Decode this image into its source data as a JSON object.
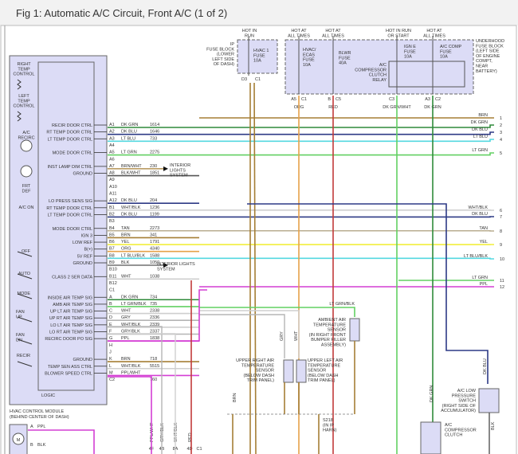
{
  "title": "Fig 1: Automatic A/C Circuit, Front A/C (1 of 2)",
  "wire_colors": {
    "DK GRN": "#2f8a3a",
    "DK BLU": "#2d3a85",
    "LT BLU": "#55d8e0",
    "LT GRN": "#62d062",
    "BRN": "#a57e35",
    "TAN": "#b8ad90",
    "YEL": "#f2ee3c",
    "ORG": "#e6a24a",
    "WHT": "#cfcfcf",
    "PPL": "#d43fd4",
    "RED": "#c23a3a",
    "GRY": "#b5b5b5",
    "BLK": "#555555"
  },
  "module": {
    "name_line1": "HVAC CONTROL MODULE",
    "name_line2": "(BEHIND CENTER OF DASH)",
    "logic": "LOGIC",
    "controls": [
      "RIGHT",
      "TEMP",
      "CONTROL",
      "LEFT",
      "TEMP",
      "CONTROL",
      "A/C",
      "RECIRC",
      "FRT",
      "DEF",
      "A/C ON",
      "OFF",
      "AUTO",
      "MODE",
      "FAN",
      "UP",
      "FAN",
      "DN",
      "RECIR"
    ],
    "pins": [
      {
        "pin": "A1",
        "func": "RECIR DOOR CTRL",
        "color": "DK GRN",
        "circuit": "1614",
        "dest": 2
      },
      {
        "pin": "A2",
        "func": "RT TEMP DOOR CTRL",
        "color": "DK BLU",
        "circuit": "1646",
        "dest": 3
      },
      {
        "pin": "A3",
        "func": "LT TEMP DOOR CTRL",
        "color": "LT BLU",
        "circuit": "733",
        "dest": 4
      },
      {
        "pin": "A4",
        "func": "",
        "color": "",
        "circuit": ""
      },
      {
        "pin": "A5",
        "func": "MODE DOOR CTRL",
        "color": "LT GRN",
        "circuit": "2275",
        "dest": 5
      },
      {
        "pin": "A6",
        "func": "",
        "color": "",
        "circuit": ""
      },
      {
        "pin": "A7",
        "func": "INST LAMP DIM CTRL",
        "color": "BRN/WHT",
        "circuit": "230"
      },
      {
        "pin": "A8",
        "func": "GROUND",
        "color": "BLK/WHT",
        "circuit": "1851"
      },
      {
        "pin": "A9",
        "func": "",
        "color": "",
        "circuit": ""
      },
      {
        "pin": "A10",
        "func": "",
        "color": "",
        "circuit": ""
      },
      {
        "pin": "A11",
        "func": "",
        "color": "",
        "circuit": ""
      },
      {
        "pin": "A12",
        "func": "LO PRESS SENS SIG",
        "color": "DK BLU",
        "circuit": "204"
      },
      {
        "pin": "B1",
        "func": "RT TEMP DOOR CTRL",
        "color": "WHT/BLK",
        "circuit": "1236",
        "dest": 6
      },
      {
        "pin": "B2",
        "func": "LT TEMP DOOR CTRL",
        "color": "DK BLU",
        "circuit": "1199",
        "dest": 7
      },
      {
        "pin": "B3",
        "func": "",
        "color": "",
        "circuit": ""
      },
      {
        "pin": "B4",
        "func": "MODE DOOR CTRL",
        "color": "TAN",
        "circuit": "2273",
        "dest": 8
      },
      {
        "pin": "B5",
        "func": "IGN 3",
        "color": "BRN",
        "circuit": "341"
      },
      {
        "pin": "B6",
        "func": "LOW REF",
        "color": "YEL",
        "circuit": "1791",
        "dest": 9
      },
      {
        "pin": "B7",
        "func": "B(+)",
        "color": "ORG",
        "circuit": "4340"
      },
      {
        "pin": "B8",
        "func": "5V REF",
        "color": "LT BLU/BLK",
        "circuit": "1588",
        "dest": 10
      },
      {
        "pin": "B9",
        "func": "GROUND",
        "color": "BLK",
        "circuit": "1050"
      },
      {
        "pin": "B10",
        "func": "",
        "color": "",
        "circuit": ""
      },
      {
        "pin": "B11",
        "func": "CLASS 2 SER DATA",
        "color": "WHT",
        "circuit": "1038"
      },
      {
        "pin": "B12",
        "func": "",
        "color": "",
        "circuit": ""
      },
      {
        "pin": "C1",
        "func": "",
        "color": "",
        "circuit": ""
      },
      {
        "pin": "A",
        "func": "INSIDE AIR TEMP SIG",
        "color": "DK GRN",
        "circuit": "734"
      },
      {
        "pin": "B",
        "func": "AMB AIR TEMP SIG",
        "color": "LT GRN/BLK",
        "circuit": "735"
      },
      {
        "pin": "C",
        "func": "UP LT AIR TEMP SIG",
        "color": "WHT",
        "circuit": "2338"
      },
      {
        "pin": "D",
        "func": "UP RT AIR TEMP SIG",
        "color": "GRY",
        "circuit": "2336"
      },
      {
        "pin": "E",
        "func": "LO LT AIR TEMP SIG",
        "color": "WHT/BLK",
        "circuit": "2339"
      },
      {
        "pin": "F",
        "func": "LO RT AIR TEMP SIG",
        "color": "GRY/BLK",
        "circuit": "2337"
      },
      {
        "pin": "G",
        "func": "RECIRC DOOR PO SIG",
        "color": "PPL",
        "circuit": "1838"
      },
      {
        "pin": "H",
        "func": "",
        "color": "",
        "circuit": ""
      },
      {
        "pin": "J",
        "func": "",
        "color": "",
        "circuit": ""
      },
      {
        "pin": "K",
        "func": "GROUND",
        "color": "BRN",
        "circuit": "718"
      },
      {
        "pin": "L",
        "func": "TEMP SEN ASS CTRL",
        "color": "WHT/BLK",
        "circuit": "5515"
      },
      {
        "pin": "M",
        "func": "BLOWER SPEED CTRL",
        "color": "PPL/WHT",
        "circuit": ""
      },
      {
        "pin": "C2",
        "func": "",
        "color": "",
        "circuit": "760"
      }
    ],
    "interior_lights_1": [
      "INTERIOR",
      "LIGHTS",
      "SYSTEM"
    ],
    "interior_lights_2": [
      "INTERIOR LIGHTS",
      "SYSTEM"
    ]
  },
  "right_refs": [
    {
      "num": "1",
      "color": "BRN"
    },
    {
      "num": "2",
      "color": "DK GRN"
    },
    {
      "num": "3",
      "color": "DK BLU"
    },
    {
      "num": "4",
      "color": "LT BLU"
    },
    {
      "num": "5",
      "color": "LT GRN"
    },
    {
      "num": "6",
      "color": "WHT/BLK"
    },
    {
      "num": "7",
      "color": "DK BLU"
    },
    {
      "num": "8",
      "color": "TAN"
    },
    {
      "num": "9",
      "color": "YEL"
    },
    {
      "num": "10",
      "color": "LT BLU/BLK"
    },
    {
      "num": "11",
      "color": "LT GRN"
    },
    {
      "num": "12",
      "color": "PPL"
    }
  ],
  "fuses": {
    "ip_block": [
      "IP",
      "FUSE BLOCK",
      "(LOWER",
      "LEFT SIDE",
      "OF DASH)"
    ],
    "ip_hot": [
      "HOT IN",
      "RUN"
    ],
    "ip_fuse": [
      "HVAC 1",
      "FUSE",
      "10A"
    ],
    "ip_pins": [
      "D3",
      "C1"
    ],
    "underhood_block": [
      "UNDERHOOD",
      "FUSE BLOCK",
      "(LEFT SIDE",
      "OF ENGINE",
      "COMPT,",
      "NEAR",
      "BATTERY)"
    ],
    "hot_all_1": [
      "HOT AT",
      "ALL TIMES"
    ],
    "hot_all_2": [
      "HOT AT",
      "ALL TIMES"
    ],
    "hot_run_start": [
      "HOT IN RUN",
      "OR START"
    ],
    "hot_all_3": [
      "HOT AT",
      "ALL TIMES"
    ],
    "hvac_ecas": [
      "HVAC/",
      "ECAS",
      "FUSE",
      "10A"
    ],
    "blwr": [
      "BLWR",
      "FUSE",
      "40A"
    ],
    "ign_e": [
      "IGN E",
      "FUSE",
      "10A"
    ],
    "ac_comp": [
      "A/C COMP",
      "FUSE",
      "10A"
    ],
    "relay": [
      "A/C",
      "COMPRESSOR",
      "CLUTCH",
      "RELAY"
    ],
    "out_pins": [
      {
        "pin": "A5",
        "conn": "C1",
        "color": "ORG"
      },
      {
        "pin": "B",
        "conn": "C5",
        "color": "RED"
      },
      {
        "pin": "C3",
        "conn": "",
        "color": "DK GRN/WHT"
      },
      {
        "pin": "A3",
        "conn": "C2",
        "color": "DK GRN"
      }
    ]
  },
  "sensors": {
    "ambient": [
      "AMBIENT AIR",
      "TEMPERATURE",
      "SENSOR",
      "(IN RIGHT FRONT",
      "BUMPER FILLER",
      "ASSEMBLY)"
    ],
    "upper_right": [
      "UPPER RIGHT AIR",
      "TEMPERATURE",
      "SENSOR",
      "(BELOW DASH",
      "TRIM PANEL)"
    ],
    "upper_left": [
      "UPPER LEFT AIR",
      "TEMPERATURE",
      "SENSOR",
      "(BELOW DASH",
      "TRIM PANEL)"
    ],
    "splice": [
      "S218",
      "(IN IP",
      "HARN)"
    ],
    "lp_switch": [
      "A/C LOW",
      "PRESSURE",
      "SWITCH",
      "(RIGHT SIDE OF",
      "ACCUMULATOR)"
    ],
    "clutch": [
      "A/C",
      "COMPRESSOR",
      "CLUTCH"
    ],
    "labels": {
      "ltgrnblk": "LT GRN/BLK",
      "gry": "GRY",
      "wht": "WHT",
      "brn": "BRN",
      "dkblu": "DK BLU",
      "dkgrn": "DK GRN",
      "blk": "BLK",
      "a": "A",
      "b": "B"
    }
  },
  "bottom": {
    "conns": [
      "4F",
      "4B",
      "8A",
      "4D",
      "C1"
    ],
    "vert_labels": [
      "PPL/WHT",
      "GRY/BLK",
      "WHT/BLK",
      "RED"
    ],
    "motor_pins": [
      {
        "pin": "A",
        "color": "PPL"
      },
      {
        "pin": "B",
        "color": "BLK"
      }
    ],
    "motor": "M"
  }
}
